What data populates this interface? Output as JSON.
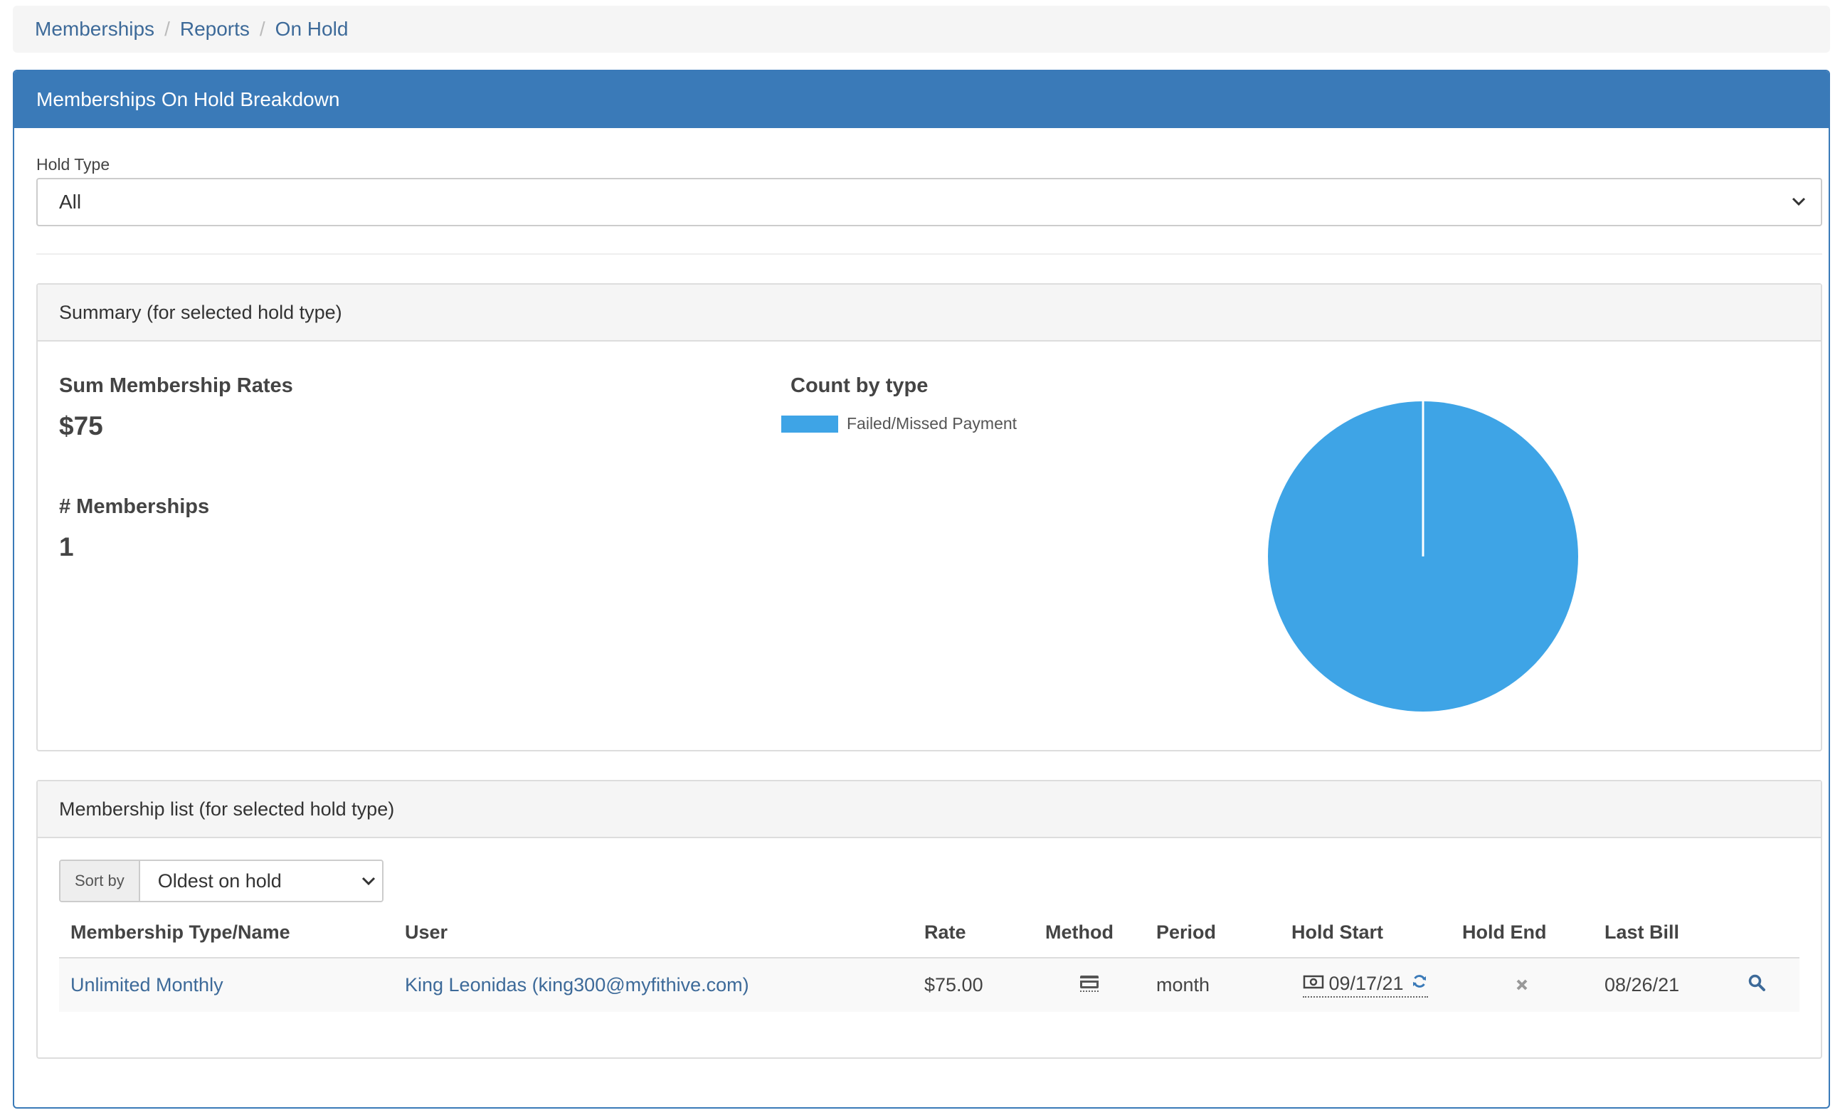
{
  "breadcrumb": {
    "items": [
      "Memberships",
      "Reports"
    ],
    "current": "On Hold"
  },
  "panel": {
    "title": "Memberships On Hold Breakdown",
    "hold_type_label": "Hold Type",
    "hold_type_value": "All"
  },
  "summary": {
    "title": "Summary (for selected hold type)",
    "sum_label": "Sum Membership Rates",
    "sum_value": "$75",
    "count_label": "# Memberships",
    "count_value": "1",
    "chart_title": "Count by type"
  },
  "chart_data": {
    "type": "pie",
    "title": "Count by type",
    "categories": [
      "Failed/Missed Payment"
    ],
    "values": [
      1
    ],
    "colors": [
      "#3ea4e6"
    ],
    "legend": "top-left"
  },
  "list": {
    "title": "Membership list (for selected hold type)",
    "sort_label": "Sort by",
    "sort_value": "Oldest on hold",
    "columns": [
      "Membership Type/Name",
      "User",
      "Rate",
      "Method",
      "Period",
      "Hold Start",
      "Hold End",
      "Last Bill"
    ],
    "rows": [
      {
        "name": "Unlimited Monthly",
        "user": "King Leonidas (king300@myfithive.com)",
        "rate": "$75.00",
        "method_icon": "credit-card-icon",
        "period": "month",
        "hold_start": "09/17/21",
        "hold_end_icon": "x-icon",
        "last_bill": "08/26/21"
      }
    ]
  },
  "colors": {
    "accent": "#3a7ab8",
    "link": "#3d6a99",
    "pie": "#3ea4e6"
  }
}
